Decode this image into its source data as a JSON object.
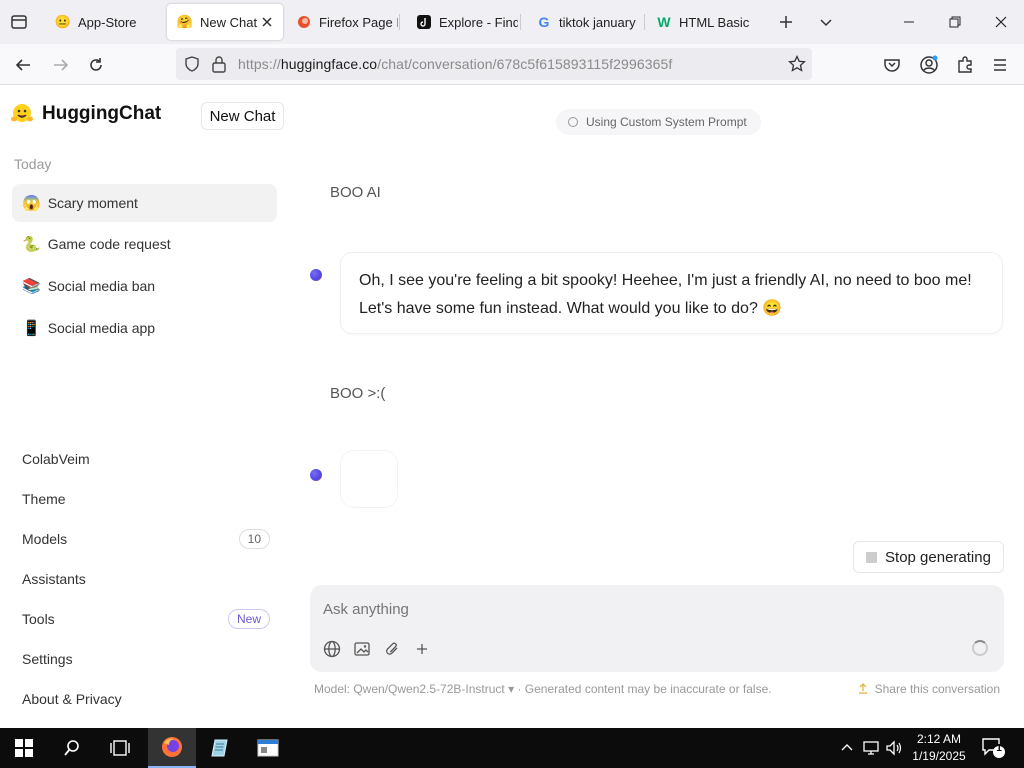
{
  "browser": {
    "tabs": [
      {
        "title": "App-Store",
        "favicon": "smile-emoji-icon"
      },
      {
        "title": "New Chat",
        "favicon": "hugging-face-icon",
        "active": true
      },
      {
        "title": "Firefox Page In",
        "favicon": "firefox-page-icon"
      },
      {
        "title": "Explore - Find",
        "favicon": "tiktok-icon"
      },
      {
        "title": "tiktok january",
        "favicon": "google-icon"
      },
      {
        "title": "HTML Basic",
        "favicon": "w3schools-icon"
      }
    ],
    "url_prefix": "https://",
    "url_host": "huggingface.co",
    "url_path": "/chat/conversation/678c5f615893115f2996365f"
  },
  "sidebar": {
    "app_name": "HuggingChat",
    "new_chat_label": "New Chat",
    "section_today": "Today",
    "conversations": [
      {
        "emoji": "😱",
        "title": "Scary moment"
      },
      {
        "emoji": "🐍",
        "title": "Game code request"
      },
      {
        "emoji": "📚",
        "title": "Social media ban"
      },
      {
        "emoji": "📱",
        "title": "Social media app"
      }
    ],
    "links": {
      "user": "ColabVeim",
      "theme": "Theme",
      "models": "Models",
      "models_count": "10",
      "assistants": "Assistants",
      "tools": "Tools",
      "tools_badge": "New",
      "settings": "Settings",
      "about": "About & Privacy"
    }
  },
  "chat": {
    "system_prompt_label": "Using Custom System Prompt",
    "messages": [
      {
        "role": "user",
        "text": "BOO AI"
      },
      {
        "role": "assistant",
        "line1": "Oh, I see you're feeling a bit spooky! Heehee, I'm just a friendly AI, no need to boo me!",
        "line2": "Let's have some fun instead. What would you like to do? 😄"
      },
      {
        "role": "user",
        "text": "BOO >:("
      }
    ],
    "stop_label": "Stop generating",
    "input_placeholder": "Ask anything",
    "model_note": "Model: Qwen/Qwen2.5-72B-Instruct ▾ · Generated content may be inaccurate or false.",
    "share_label": "Share this conversation"
  },
  "taskbar": {
    "time": "2:12 AM",
    "date": "1/19/2025",
    "notification_count": "1"
  },
  "colors": {
    "accent": "#4f46e5",
    "taskbar": "#0c0c0c"
  }
}
